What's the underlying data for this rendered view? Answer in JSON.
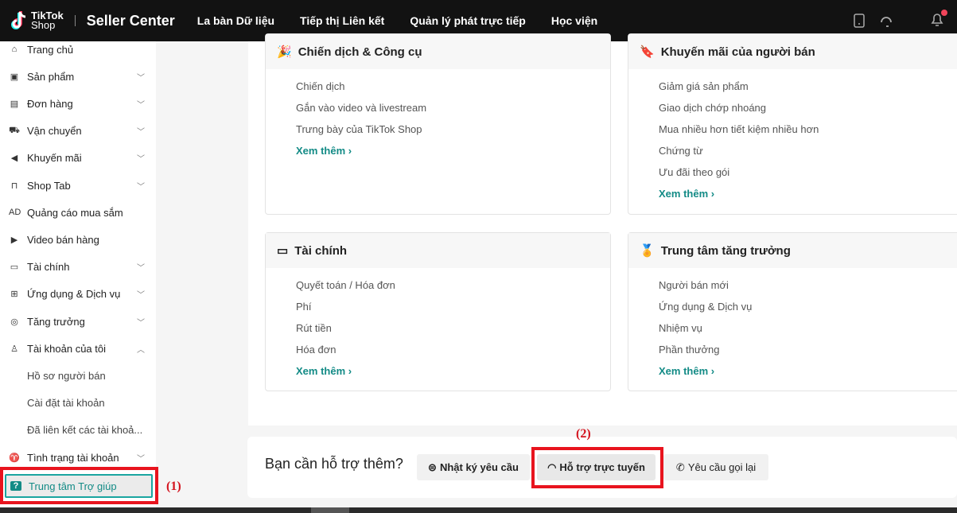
{
  "header": {
    "logo_top": "TikTok",
    "logo_bottom": "Shop",
    "title": "Seller Center",
    "nav": [
      "La bàn Dữ liệu",
      "Tiếp thị Liên kết",
      "Quản lý phát trực tiếp",
      "Học viện"
    ]
  },
  "sidebar": {
    "items": [
      {
        "label": "Trang chủ",
        "icon": "home-icon"
      },
      {
        "label": "Sản phẩm",
        "icon": "product-icon",
        "chevron": "down"
      },
      {
        "label": "Đơn hàng",
        "icon": "clipboard-icon",
        "chevron": "down"
      },
      {
        "label": "Vận chuyển",
        "icon": "truck-icon",
        "chevron": "down"
      },
      {
        "label": "Khuyến mãi",
        "icon": "megaphone-icon",
        "chevron": "down"
      },
      {
        "label": "Shop Tab",
        "icon": "bag-icon",
        "chevron": "down"
      },
      {
        "label": "Quảng cáo mua sắm",
        "icon": "ad-icon"
      },
      {
        "label": "Video bán hàng",
        "icon": "video-icon"
      },
      {
        "label": "Tài chính",
        "icon": "finance-icon",
        "chevron": "down"
      },
      {
        "label": "Ứng dụng & Dịch vụ",
        "icon": "apps-icon",
        "chevron": "down"
      },
      {
        "label": "Tăng trưởng",
        "icon": "medal-icon",
        "chevron": "down"
      },
      {
        "label": "Tài khoản của tôi",
        "icon": "user-icon",
        "chevron": "up"
      },
      {
        "label": "Hồ sơ người bán",
        "sub": true
      },
      {
        "label": "Cài đặt tài khoản",
        "sub": true
      },
      {
        "label": "Đã liên kết các tài khoả...",
        "sub": true
      },
      {
        "label": "Tình trạng tài khoản",
        "icon": "trophy-icon",
        "chevron": "down"
      },
      {
        "label": "Trung tâm Trợ giúp",
        "icon": "help-icon",
        "active": true
      }
    ]
  },
  "cards": [
    {
      "title": "Chiến dịch & Công cụ",
      "links": [
        "Chiến dịch",
        "Gắn vào video và livestream",
        "Trưng bày của TikTok Shop"
      ],
      "more": "Xem thêm ›"
    },
    {
      "title": "Khuyến mãi của người bán",
      "links": [
        "Giảm giá sản phẩm",
        "Giao dịch chớp nhoáng",
        "Mua nhiều hơn tiết kiệm nhiều hơn",
        "Chứng từ",
        "Ưu đãi theo gói"
      ],
      "more": "Xem thêm ›"
    },
    {
      "title": "Tài chính",
      "links": [
        "Quyết toán / Hóa đơn",
        "Phí",
        "Rút tiền",
        "Hóa đơn"
      ],
      "more": "Xem thêm ›"
    },
    {
      "title": "Trung tâm tăng trưởng",
      "links": [
        "Người bán mới",
        "Ứng dụng & Dịch vụ",
        "Nhiệm vụ",
        "Phần thưởng"
      ],
      "more": "Xem thêm ›"
    }
  ],
  "support": {
    "question": "Bạn cần hỗ trợ thêm?",
    "buttons": [
      "Nhật ký yêu cầu",
      "Hỗ trợ trực tuyến",
      "Yêu cầu gọi lại"
    ]
  },
  "annotations": [
    "(1)",
    "(2)"
  ],
  "colors": {
    "accent": "#138b86",
    "highlight": "#e8141e",
    "header": "#121212"
  }
}
